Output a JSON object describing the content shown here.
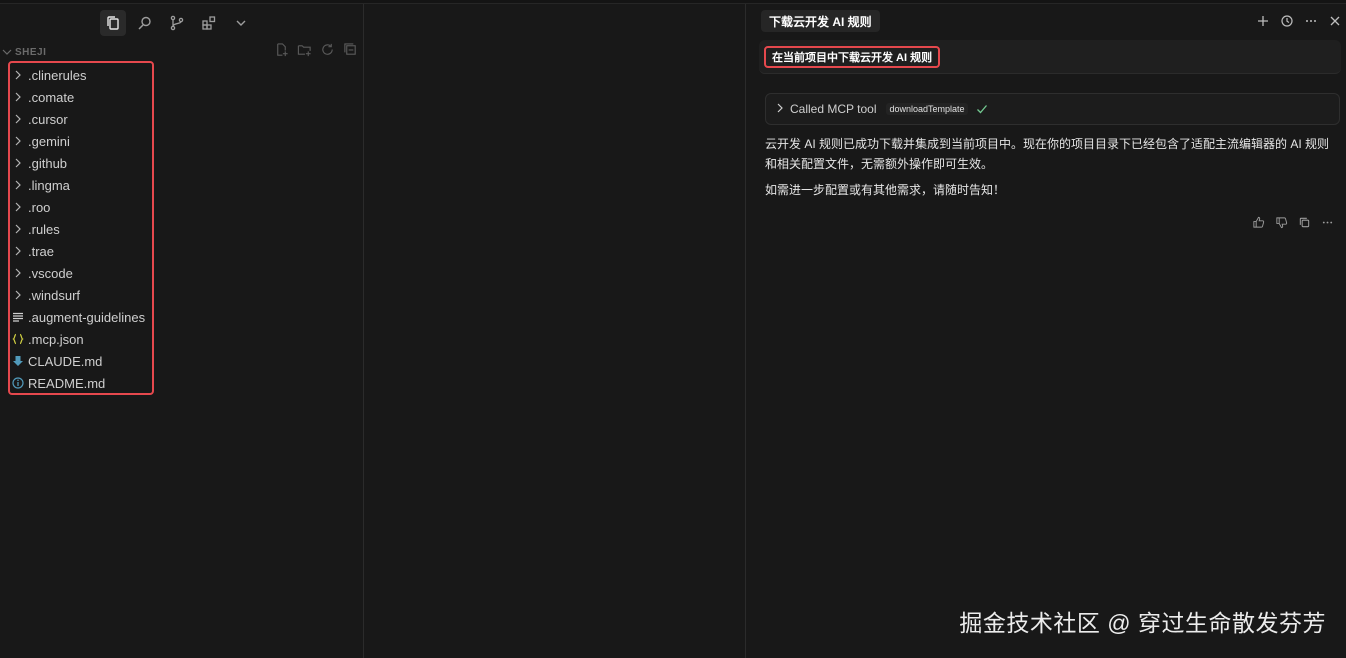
{
  "explorer": {
    "title": "SHEJI",
    "items": [
      {
        "label": ".clinerules",
        "kind": "folder"
      },
      {
        "label": ".comate",
        "kind": "folder"
      },
      {
        "label": ".cursor",
        "kind": "folder"
      },
      {
        "label": ".gemini",
        "kind": "folder"
      },
      {
        "label": ".github",
        "kind": "folder"
      },
      {
        "label": ".lingma",
        "kind": "folder"
      },
      {
        "label": ".roo",
        "kind": "folder"
      },
      {
        "label": ".rules",
        "kind": "folder"
      },
      {
        "label": ".trae",
        "kind": "folder"
      },
      {
        "label": ".vscode",
        "kind": "folder"
      },
      {
        "label": ".windsurf",
        "kind": "folder"
      },
      {
        "label": ".augment-guidelines",
        "kind": "lines-icon"
      },
      {
        "label": ".mcp.json",
        "kind": "json-icon"
      },
      {
        "label": "CLAUDE.md",
        "kind": "download-icon"
      },
      {
        "label": "README.md",
        "kind": "info-icon"
      }
    ]
  },
  "chat": {
    "tab_title": "下载云开发 AI 规则",
    "user_message": "在当前项目中下载云开发 AI 规则",
    "tool_call": {
      "label": "Called MCP tool",
      "tool_name": "downloadTemplate"
    },
    "assistant_paragraphs": [
      "云开发 AI 规则已成功下载并集成到当前项目中。现在你的项目目录下已经包含了适配主流编辑器的 AI 规则和相关配置文件，无需额外操作即可生效。",
      "如需进一步配置或有其他需求，请随时告知！"
    ]
  },
  "watermark": "掘金技术社区 @ 穿过生命散发芬芳",
  "colors": {
    "background": "#181818",
    "highlight_border": "#e5484d",
    "success_check": "#73c991"
  }
}
